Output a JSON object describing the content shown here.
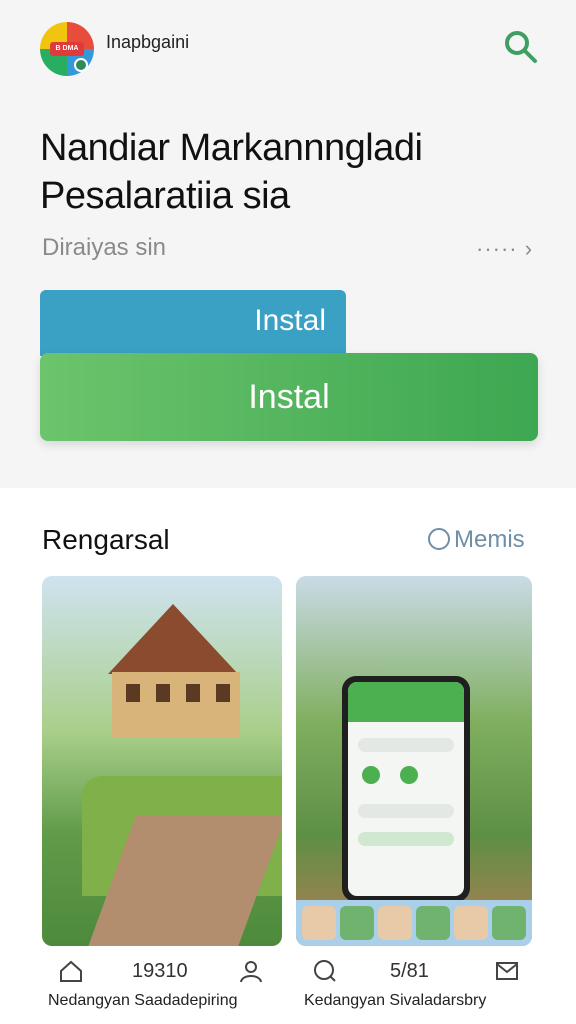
{
  "header": {
    "brand": "Inapbgaini",
    "logo_badge": "B DMA"
  },
  "hero": {
    "title_line1": "Nandiar Markannngladi",
    "title_line2": "Pesalaratiia sia",
    "subtitle": "Diraiyas sin",
    "more": "·····"
  },
  "buttons": {
    "secondary_label": "Instal",
    "primary_label": "Instal"
  },
  "section": {
    "title": "Rengarsal",
    "link": "Memis"
  },
  "cards": [
    {
      "stat": "19310",
      "caption": "Nedangyan Saadadepiring"
    },
    {
      "stat": "5/81",
      "caption": "Kedangyan Sivaladarsbry"
    }
  ],
  "colors": {
    "accent_green": "#4caf50",
    "accent_blue": "#3aa0c4",
    "link": "#6f8fa8"
  },
  "icons": [
    "search-icon",
    "chevron-right-icon",
    "home-icon",
    "user-icon",
    "chat-icon",
    "mail-icon"
  ]
}
